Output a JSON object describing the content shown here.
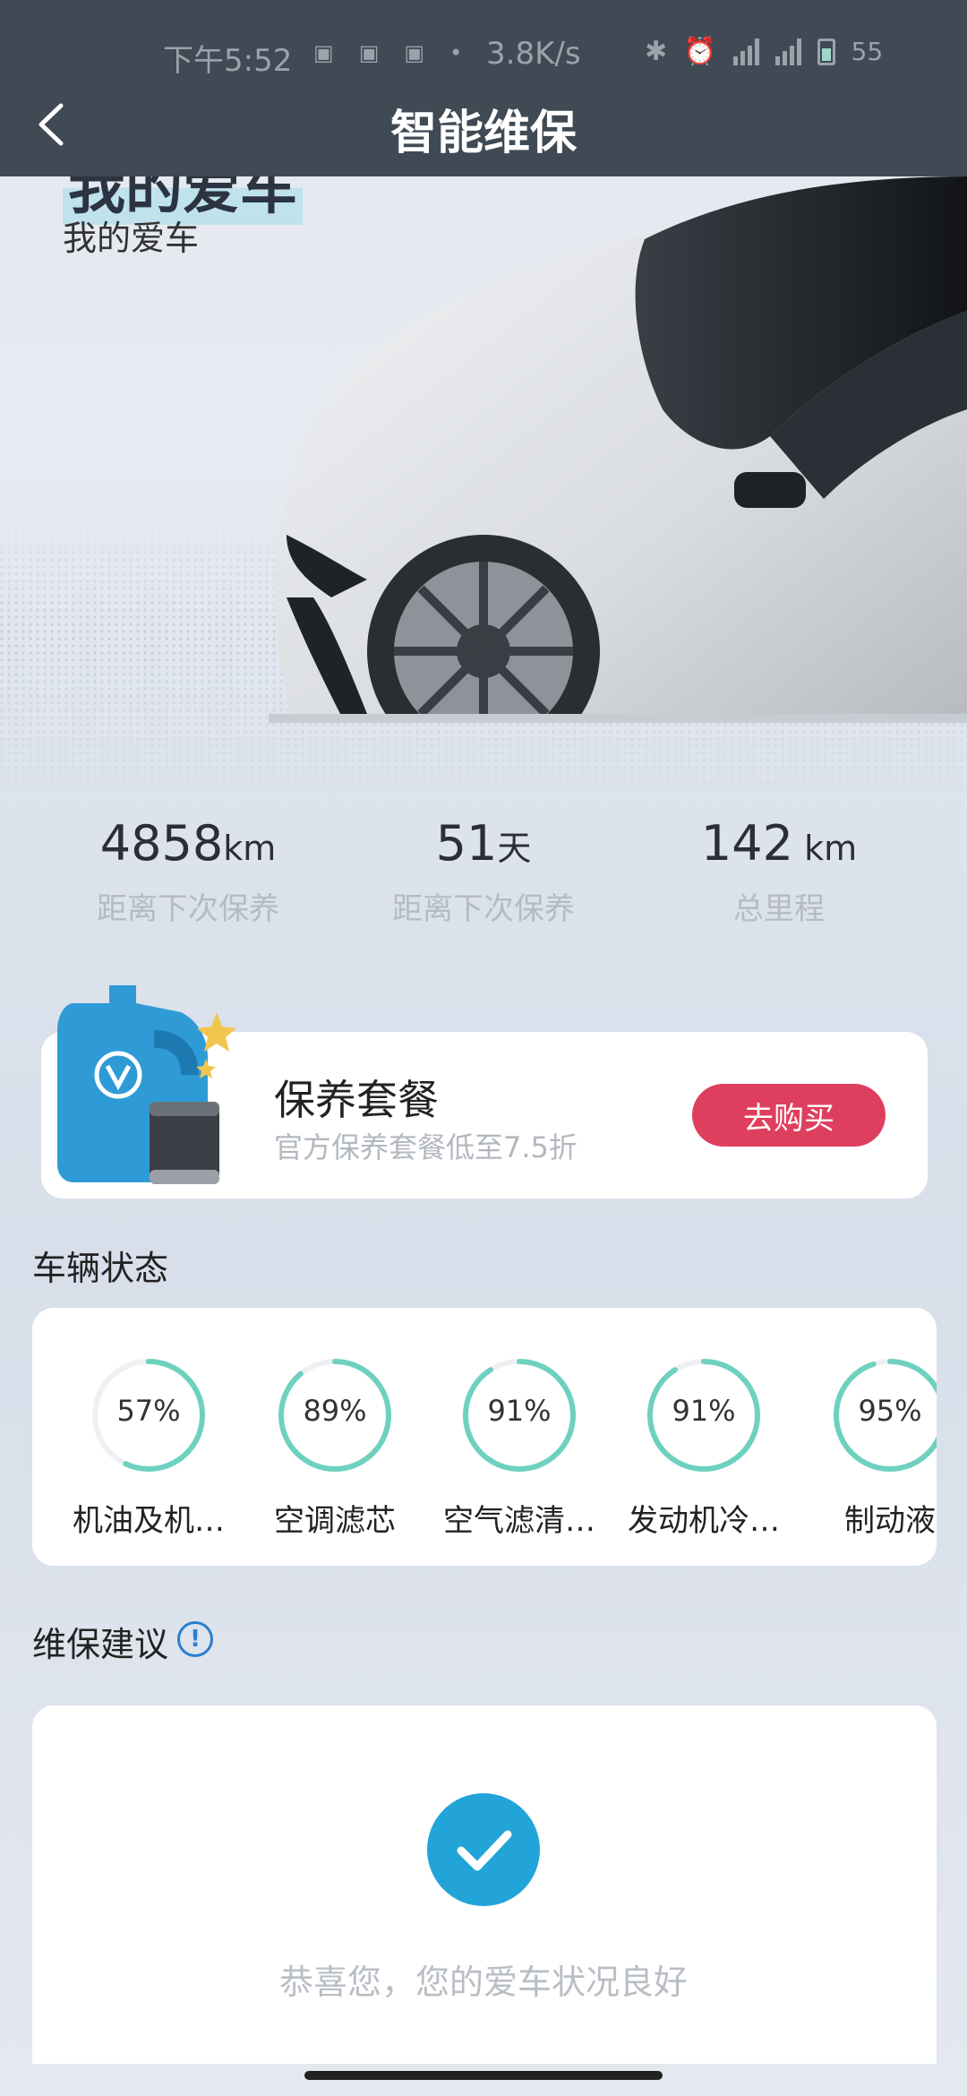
{
  "status_bar": {
    "time": "下午5:52",
    "net_speed": "3.8K/s",
    "battery_level": "55"
  },
  "header": {
    "title": "智能维保"
  },
  "hero": {
    "title_big": "我的爱车",
    "subtitle": "我的爱车"
  },
  "stats": [
    {
      "value": "4858",
      "unit": "km",
      "label": "距离下次保养"
    },
    {
      "value": "51",
      "unit": "天",
      "label": "距离下次保养"
    },
    {
      "value": "142",
      "unit": " km",
      "label": "总里程"
    }
  ],
  "package": {
    "title": "保养套餐",
    "description": "官方保养套餐低至7.5折",
    "buy_label": "去购买"
  },
  "vehicle_status": {
    "title": "车辆状态",
    "items": [
      {
        "percent_text": "57%",
        "percent": 57,
        "label": "机油及机…"
      },
      {
        "percent_text": "89%",
        "percent": 89,
        "label": "空调滤芯"
      },
      {
        "percent_text": "91%",
        "percent": 91,
        "label": "空气滤清…"
      },
      {
        "percent_text": "91%",
        "percent": 91,
        "label": "发动机冷…"
      },
      {
        "percent_text": "95%",
        "percent": 95,
        "label": "制动液"
      }
    ]
  },
  "advice": {
    "title": "维保建议",
    "message": "恭喜您，您的爱车状况良好"
  },
  "colors": {
    "header_bg": "#3f4a54",
    "buy_button": "#df3f5e",
    "gauge_ring": "#6ed1bf",
    "check": "#22a4d8"
  }
}
